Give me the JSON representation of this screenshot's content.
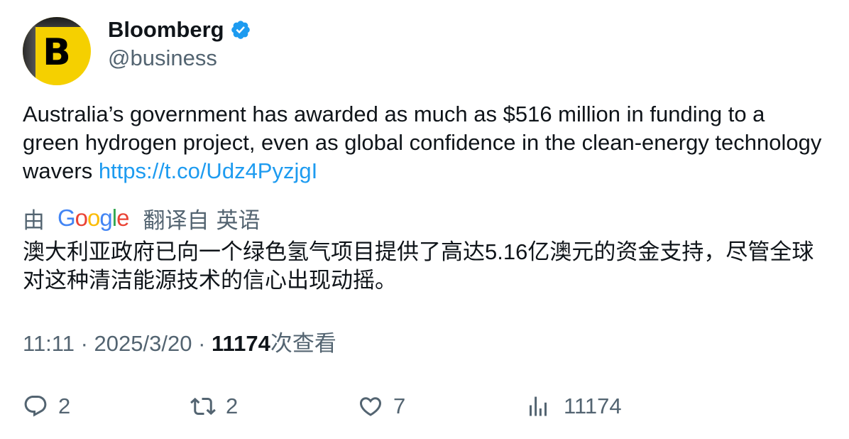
{
  "author": {
    "avatar_letter": "B",
    "avatar_color": "#f5d000",
    "display_name": "Bloomberg",
    "verified_icon": "verified-badge-icon",
    "verified_color": "#1d9bf0",
    "handle": "@business"
  },
  "tweet": {
    "text": "Australia’s government has awarded as much as $516 million in funding to a green hydrogen project, even as global confidence in the clean-energy technology wavers ",
    "link": "https://t.co/Udz4PyzjgI",
    "link_color": "#1d9bf0"
  },
  "translation": {
    "by_label": "由",
    "provider_letters": [
      "G",
      "o",
      "o",
      "g",
      "l",
      "e"
    ],
    "from_label": "翻译自",
    "language": "英语",
    "text": "澳大利亚政府已向一个绿色氢气项目提供了高达5.16亿澳元的资金支持，尽管全球对这种清洁能源技术的信心出现动摇。"
  },
  "meta": {
    "time": "11:11",
    "separator": " · ",
    "date": "2025/3/20",
    "views_count": "11174",
    "views_label": "次查看"
  },
  "actions": {
    "reply": {
      "icon": "reply-icon",
      "count": "2"
    },
    "retweet": {
      "icon": "retweet-icon",
      "count": "2"
    },
    "like": {
      "icon": "heart-icon",
      "count": "7"
    },
    "views": {
      "icon": "views-chart-icon",
      "count": "11174"
    }
  },
  "colors": {
    "text_primary": "#0f1419",
    "text_secondary": "#536471"
  }
}
